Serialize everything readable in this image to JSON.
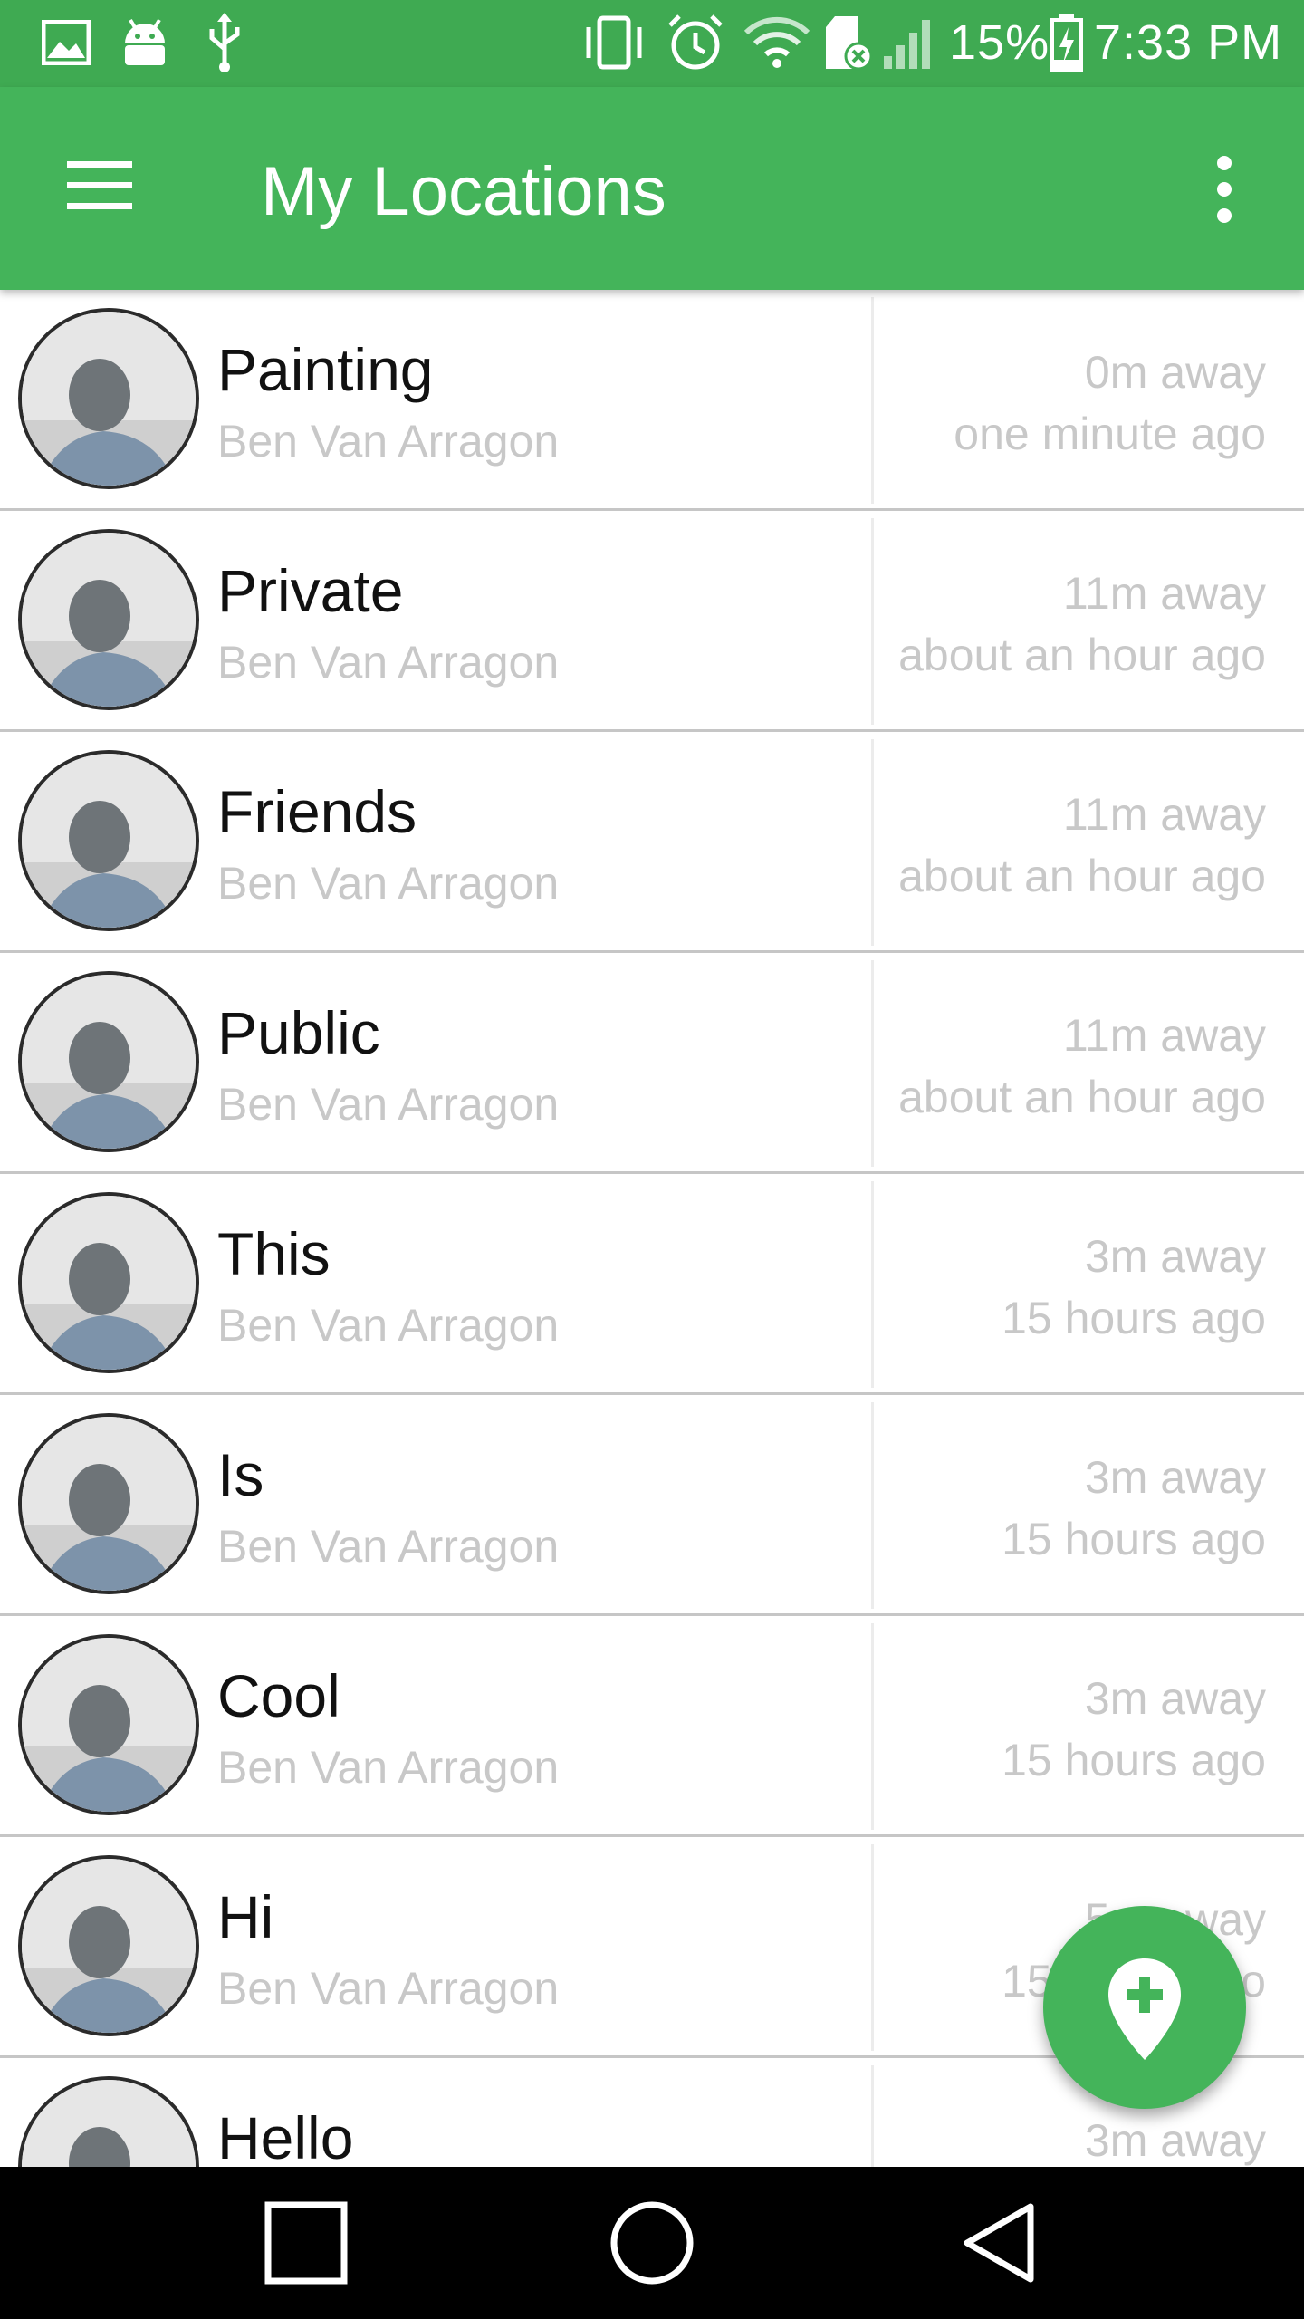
{
  "status_bar": {
    "battery": "15%",
    "time": "7:33 PM",
    "icons": [
      "gallery-icon",
      "android-icon",
      "usb-icon",
      "vibrate-icon",
      "alarm-icon",
      "wifi-icon",
      "sd-card-icon",
      "signal-icon",
      "battery-charging-icon"
    ]
  },
  "app_bar": {
    "title": "My Locations",
    "menu_icon": "hamburger-menu-icon",
    "more_icon": "more-vert-icon"
  },
  "locations": [
    {
      "title": "Painting",
      "owner": "Ben Van Arragon",
      "distance": "0m away",
      "time": "one minute ago"
    },
    {
      "title": "Private",
      "owner": "Ben Van Arragon",
      "distance": "11m away",
      "time": "about an hour ago"
    },
    {
      "title": "Friends",
      "owner": "Ben Van Arragon",
      "distance": "11m away",
      "time": "about an hour ago"
    },
    {
      "title": "Public",
      "owner": "Ben Van Arragon",
      "distance": "11m away",
      "time": "about an hour ago"
    },
    {
      "title": "This",
      "owner": "Ben Van Arragon",
      "distance": "3m away",
      "time": "15 hours ago"
    },
    {
      "title": "Is",
      "owner": "Ben Van Arragon",
      "distance": "3m away",
      "time": "15 hours ago"
    },
    {
      "title": "Cool",
      "owner": "Ben Van Arragon",
      "distance": "3m away",
      "time": "15 hours ago"
    },
    {
      "title": "Hi",
      "owner": "Ben Van Arragon",
      "distance": "5m away",
      "time": "15 hours ago"
    },
    {
      "title": "Hello",
      "owner": "",
      "distance": "3m away",
      "time": ""
    }
  ],
  "fab": {
    "icon": "add-location-icon"
  },
  "nav_bar": {
    "icons": [
      "recent-apps-icon",
      "home-icon",
      "back-icon"
    ]
  },
  "colors": {
    "primary": "#44b45a",
    "status": "#3faa52",
    "subtext": "#c8c8c8"
  }
}
